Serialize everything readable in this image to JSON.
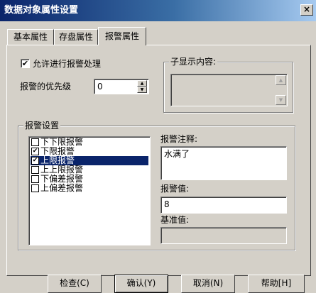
{
  "window": {
    "title": "数据对象属性设置",
    "close_glyph": "×"
  },
  "tabs": [
    {
      "label": "基本属性",
      "active": false
    },
    {
      "label": "存盘属性",
      "active": false
    },
    {
      "label": "报警属性",
      "active": true
    }
  ],
  "alarm": {
    "allow_label": "允许进行报警处理",
    "allow_checked": true,
    "check_glyph": "✔",
    "priority_label": "报警的优先级",
    "priority_value": "0",
    "sub_display_title": "子显示内容:",
    "settings_title": "报警设置",
    "list_items": [
      {
        "label": "下下限报警",
        "checked": false,
        "selected": false
      },
      {
        "label": "下限报警",
        "checked": true,
        "selected": false
      },
      {
        "label": "上限报警",
        "checked": true,
        "selected": true
      },
      {
        "label": "上上限报警",
        "checked": false,
        "selected": false
      },
      {
        "label": "下偏差报警",
        "checked": false,
        "selected": false
      },
      {
        "label": "上偏差报警",
        "checked": false,
        "selected": false
      }
    ],
    "comment_label": "报警注释:",
    "comment_value": "水满了",
    "value_label": "报警值:",
    "value_value": "8",
    "base_label": "基准值:",
    "base_value": ""
  },
  "buttons": {
    "check": "检查(C)",
    "ok": "确认(Y)",
    "cancel": "取消(N)",
    "help": "帮助[H]"
  },
  "icons": {
    "spin_up": "▲",
    "spin_down": "▼"
  }
}
